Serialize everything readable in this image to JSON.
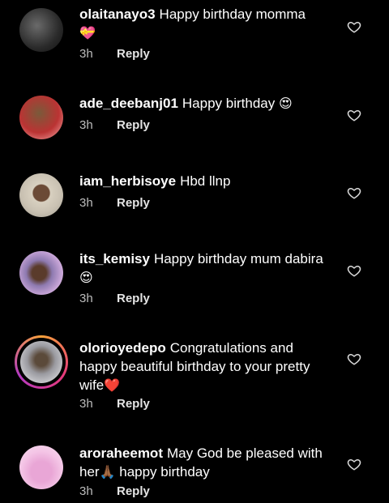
{
  "comments": [
    {
      "username": "olaitanayo3",
      "text": "Happy birthday momma",
      "emoji": "💝",
      "time": "3h",
      "reply": "Reply"
    },
    {
      "username": "ade_deebanj01",
      "text": "Happy birthday",
      "emoji": "😍",
      "time": "3h",
      "reply": "Reply"
    },
    {
      "username": "iam_herbisoye",
      "text": "Hbd llnp",
      "emoji": "",
      "time": "3h",
      "reply": "Reply"
    },
    {
      "username": "its_kemisy",
      "text": "Happy birthday mum dabira",
      "emoji": "😍",
      "time": "3h",
      "reply": "Reply"
    },
    {
      "username": "olorioyedepo",
      "text": "Congratulations and happy beautiful birthday to your pretty wife",
      "emoji": "❤️",
      "time": "3h",
      "reply": "Reply"
    },
    {
      "username": "aroraheemot",
      "text_before": "May God be pleased with her",
      "emoji": "🙏🏾",
      "text_after": "happy birthday",
      "time": "3h",
      "reply": "Reply"
    }
  ],
  "colors": {
    "background": "#000000",
    "text": "#ffffff",
    "muted": "#bdbdbd",
    "heart_icon": "#d9d9d9"
  },
  "icons": {
    "like": "heart-outline-icon"
  }
}
